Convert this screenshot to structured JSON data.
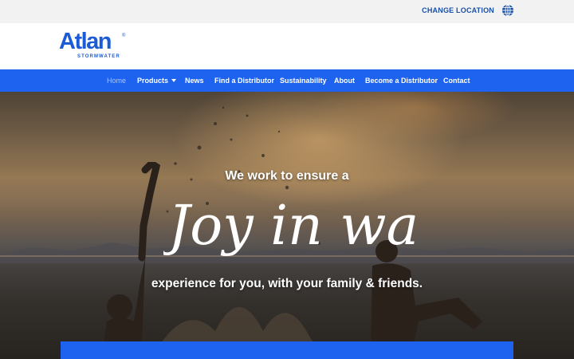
{
  "topbar": {
    "change_location": "CHANGE LOCATION",
    "globe_icon": "globe-icon"
  },
  "logo": {
    "word": "Atlan",
    "registered": "®",
    "sub": "STORMWATER"
  },
  "nav": {
    "items": [
      {
        "label": "Home",
        "active": true
      },
      {
        "label": "Products",
        "dropdown": true
      },
      {
        "label": "News"
      },
      {
        "label": "Find a Distributor"
      },
      {
        "label": "Sustainability"
      },
      {
        "label": "About"
      },
      {
        "label": "Become a Distributor"
      },
      {
        "label": "Contact"
      }
    ]
  },
  "hero": {
    "line1": "We work to ensure a",
    "script_text": "Joy in water",
    "line2": "experience for you, with your family & friends."
  },
  "colors": {
    "brand_blue": "#1e63f0",
    "logo_blue": "#1c5bd6",
    "link_blue": "#1a4fa3"
  }
}
